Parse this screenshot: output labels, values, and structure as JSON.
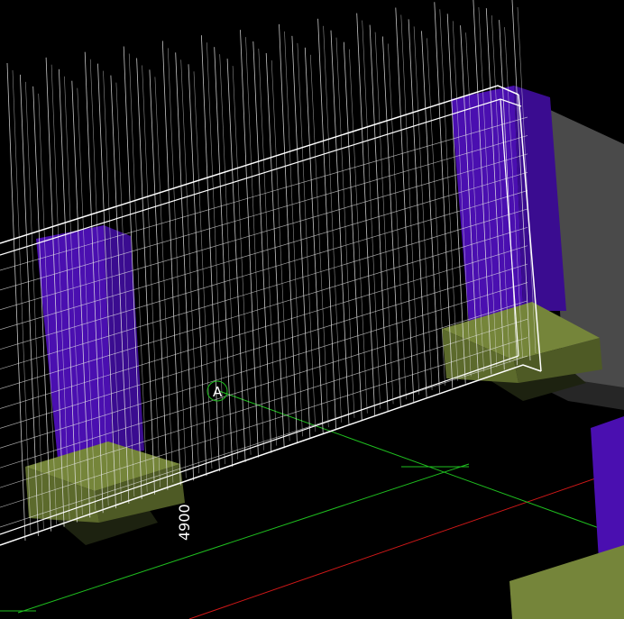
{
  "viewport": {
    "background_color": "#000000",
    "grid_axis_label": "A",
    "dimension_label": "4900"
  },
  "colors": {
    "column_purple": "#4a0fb0",
    "column_purple_dark": "#2a0a6a",
    "footing_olive": "#5c6a2c",
    "footing_olive_light": "#75853a",
    "wall_gray": "#4a4a4a",
    "wireframe": "#e8e8e8",
    "grid_green": "#1fbf1f",
    "grid_red": "#d01818"
  },
  "icons": {
    "grid_bubble": "circle-outline"
  }
}
